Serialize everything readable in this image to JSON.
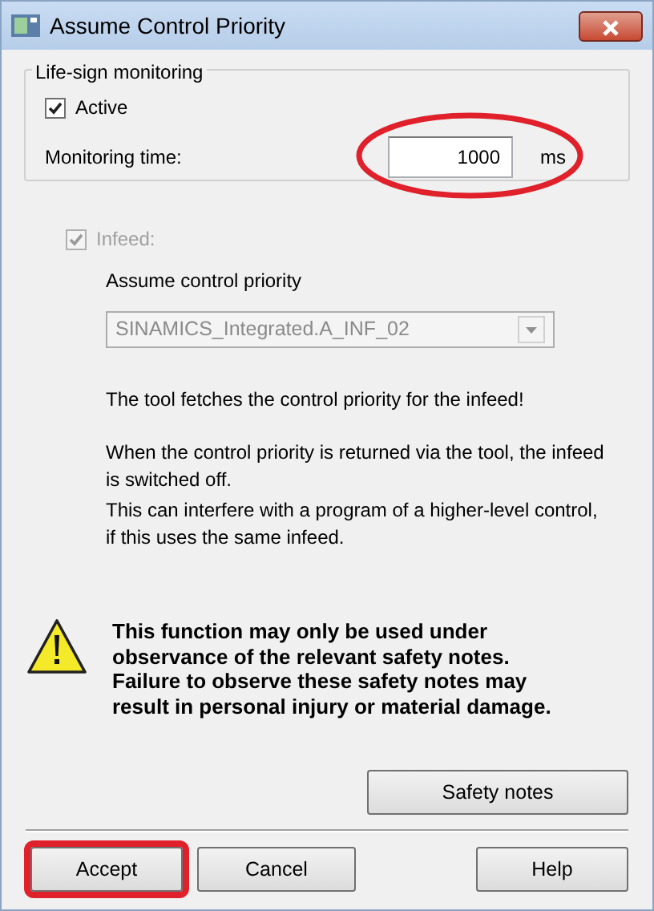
{
  "window": {
    "title": "Assume Control Priority"
  },
  "life_sign_monitoring": {
    "legend": "Life-sign monitoring",
    "active": {
      "label": "Active",
      "checked": true
    },
    "monitoring_time": {
      "label": "Monitoring time:",
      "value": "1000",
      "unit": "ms",
      "highlighted": true
    }
  },
  "infeed": {
    "label": "Infeed:",
    "checked": true,
    "disabled": true,
    "dropdown_label": "Assume control priority",
    "dropdown": {
      "value": "SINAMICS_Integrated.A_INF_02",
      "disabled": true
    },
    "notes": [
      "The tool fetches the control priority for the infeed!",
      "When the control priority is returned via the tool, the infeed is switched off.",
      "This can interfere with a program of a higher-level control, if this uses the same infeed."
    ]
  },
  "warning": "This function may only be used under observance of the relevant safety notes. Failure to observe these safety notes may result in personal injury or material damage.",
  "safety_notes_button": "Safety notes",
  "buttons": [
    {
      "label": "Accept",
      "highlighted": true
    },
    {
      "label": "Cancel",
      "highlighted": false
    },
    {
      "label": "Help",
      "highlighted": false
    }
  ]
}
